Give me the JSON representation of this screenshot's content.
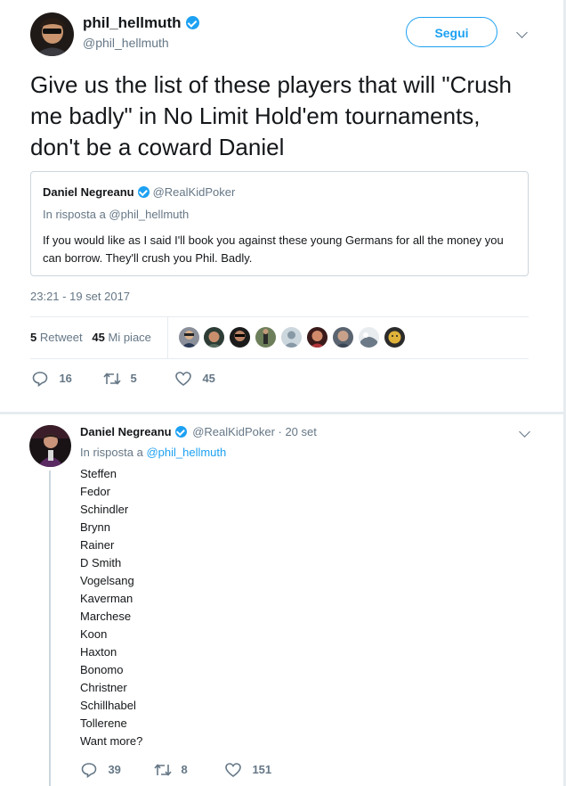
{
  "main_tweet": {
    "author_name": "phil_hellmuth",
    "handle": "@phil_hellmuth",
    "follow_label": "Segui",
    "text": "Give us the list of these players that will \"Crush me badly\" in No Limit Hold'em tournaments, don't be a coward Daniel",
    "timestamp": "23:21 - 19 set 2017",
    "retweet_count": "5",
    "retweet_label": "Retweet",
    "like_count": "45",
    "like_label": "Mi piace",
    "actions": {
      "replies": "16",
      "retweets": "5",
      "likes": "45"
    }
  },
  "quote": {
    "author_name": "Daniel Negreanu",
    "handle": "@RealKidPoker",
    "reply_to": "In risposta a @phil_hellmuth",
    "text": "If you would like as I said I'll book you against these young Germans for all the money you can borrow. They'll crush you Phil. Badly."
  },
  "reply_tweet": {
    "author_name": "Daniel Negreanu",
    "handle_date": "@RealKidPoker · 20 set",
    "reply_prefix": "In risposta a",
    "reply_to": "@phil_hellmuth",
    "lines": [
      "Steffen",
      "Fedor",
      "Schindler",
      "Brynn",
      "Rainer",
      "D Smith",
      "Vogelsang",
      "Kaverman",
      "Marchese",
      "Koon",
      "Haxton",
      "Bonomo",
      "Christner",
      "Schillhabel",
      "Tollerene",
      "Want more?"
    ],
    "actions": {
      "replies": "39",
      "retweets": "8",
      "likes": "151"
    }
  },
  "colors": {
    "accent": "#1da1f2",
    "muted": "#657786",
    "text": "#14171a",
    "border": "#e6ecf0"
  },
  "icons": [
    "verified-icon",
    "chevron-down-icon",
    "reply-icon",
    "retweet-icon",
    "like-icon"
  ]
}
